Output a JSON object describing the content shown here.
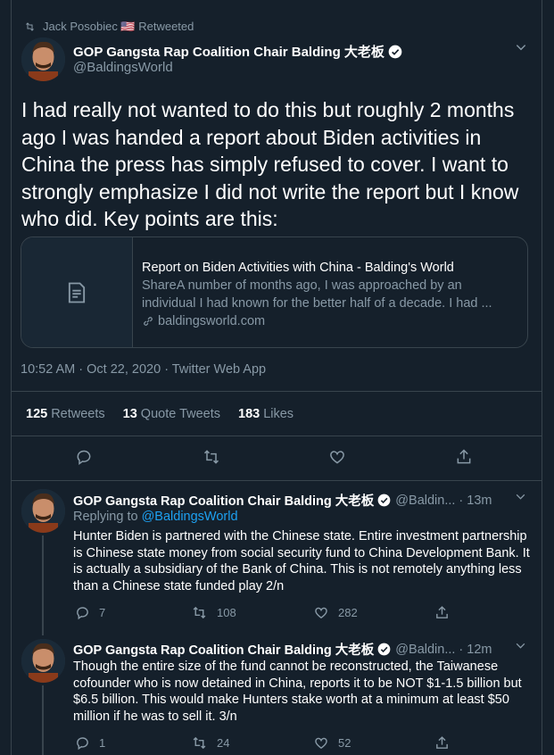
{
  "retweet_by": "Jack Posobiec 🇺🇸 Retweeted",
  "main_tweet": {
    "name": "GOP Gangsta Rap Coalition Chair Balding 大老板",
    "handle": "@BaldingsWorld",
    "text": "I had really not wanted to do this but roughly 2 months ago I was handed a report about Biden activities in China the press has simply refused to cover. I want to strongly emphasize I did not write the report but I know who did. Key points are this:",
    "card": {
      "title": "Report on Biden Activities with China - Balding's World",
      "description": "ShareA number of months ago, I was approached by an individual I had known for the better half of a decade. I had ...",
      "domain": "baldingsworld.com"
    },
    "timestamp": "10:52 AM · Oct 22, 2020 · Twitter Web App",
    "stats": {
      "retweets_count": "125",
      "retweets_label": "Retweets",
      "quotes_count": "13",
      "quotes_label": "Quote Tweets",
      "likes_count": "183",
      "likes_label": "Likes"
    }
  },
  "replies": [
    {
      "name": "GOP Gangsta Rap Coalition Chair Balding 大老板",
      "handle": "@Baldin...",
      "time": "· 13m",
      "replying_label": "Replying to",
      "replying_to": "@BaldingsWorld",
      "text": "Hunter Biden is partnered with the Chinese state. Entire investment partnership is Chinese state money from social security fund to China Development Bank. It is actually a subsidiary of the Bank of China. This is not remotely anything less than a Chinese state funded play 2/n",
      "replies": "7",
      "retweets": "108",
      "likes": "282"
    },
    {
      "name": "GOP Gangsta Rap Coalition Chair Balding 大老板",
      "handle": "@Baldin...",
      "time": "· 12m",
      "text": "Though the entire size of the fund cannot be reconstructed, the Taiwanese cofounder who is now detained in China, reports it to be NOT $1-1.5 billion but $6.5 billion. This would make Hunters stake worth at a minimum at least $50 million if he was to sell it. 3/n",
      "replies": "1",
      "retweets": "24",
      "likes": "52"
    }
  ],
  "colors": {
    "background": "#15202b",
    "muted": "#8899a6",
    "accent": "#1da1f2",
    "border": "#38444d"
  }
}
